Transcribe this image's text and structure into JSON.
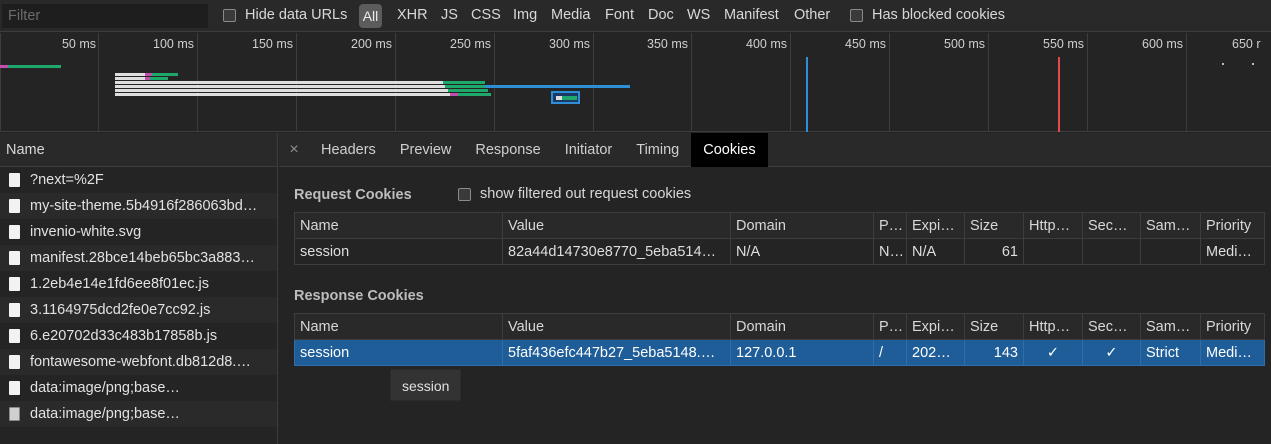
{
  "filter": {
    "placeholder": "Filter",
    "value": ""
  },
  "toolbar": {
    "hide_data_urls": "Hide data URLs",
    "types": [
      "All",
      "XHR",
      "JS",
      "CSS",
      "Img",
      "Media",
      "Font",
      "Doc",
      "WS",
      "Manifest",
      "Other"
    ],
    "has_blocked_cookies": "Has blocked cookies"
  },
  "overview": {
    "ticks": [
      "50 ms",
      "100 ms",
      "150 ms",
      "200 ms",
      "250 ms",
      "300 ms",
      "350 ms",
      "400 ms",
      "450 ms",
      "500 ms",
      "550 ms",
      "600 ms",
      "650 r"
    ],
    "colors": {
      "dom_content_loaded": "#2f8fd6",
      "load": "#e2494a",
      "waiting": "#1fa86b",
      "queue": "#dedede"
    }
  },
  "requests": {
    "header": "Name",
    "items": [
      {
        "name": "?next=%2F",
        "icon": "document-icon"
      },
      {
        "name": "my-site-theme.5b4916f286063bd…",
        "icon": "document-icon"
      },
      {
        "name": "invenio-white.svg",
        "icon": "document-icon"
      },
      {
        "name": "manifest.28bce14beb65bc3a883…",
        "icon": "document-icon"
      },
      {
        "name": "1.2eb4e14e1fd6ee8f01ec.js",
        "icon": "document-icon"
      },
      {
        "name": "3.1164975dcd2fe0e7cc92.js",
        "icon": "document-icon"
      },
      {
        "name": "6.e20702d33c483b17858b.js",
        "icon": "document-icon"
      },
      {
        "name": "fontawesome-webfont.db812d8.…",
        "icon": "document-icon"
      },
      {
        "name": "data:image/png;base…",
        "icon": "document-icon"
      },
      {
        "name": "data:image/png;base…",
        "icon": "image-icon"
      }
    ]
  },
  "detail": {
    "close": "×",
    "tabs": [
      "Headers",
      "Preview",
      "Response",
      "Initiator",
      "Timing",
      "Cookies"
    ],
    "active_tab": "Cookies"
  },
  "request_cookies": {
    "title": "Request Cookies",
    "show_filtered": "show filtered out request cookies",
    "columns": [
      "Name",
      "Value",
      "Domain",
      "P…",
      "Expi…",
      "Size",
      "Http…",
      "Sec…",
      "Sam…",
      "Priority"
    ],
    "rows": [
      [
        "session",
        "82a44d14730e8770_5eba514…",
        "N/A",
        "N…",
        "N/A",
        "61",
        "",
        "",
        "",
        "Medi…"
      ]
    ]
  },
  "response_cookies": {
    "title": "Response Cookies",
    "columns": [
      "Name",
      "Value",
      "Domain",
      "P…",
      "Expi…",
      "Size",
      "Http…",
      "Sec…",
      "Sam…",
      "Priority"
    ],
    "rows": [
      [
        "session",
        "5faf436efc447b27_5eba5148.…",
        "127.0.0.1",
        "/",
        "202…",
        "143",
        "✓",
        "✓",
        "Strict",
        "Medi…"
      ]
    ]
  },
  "tooltip": "session"
}
